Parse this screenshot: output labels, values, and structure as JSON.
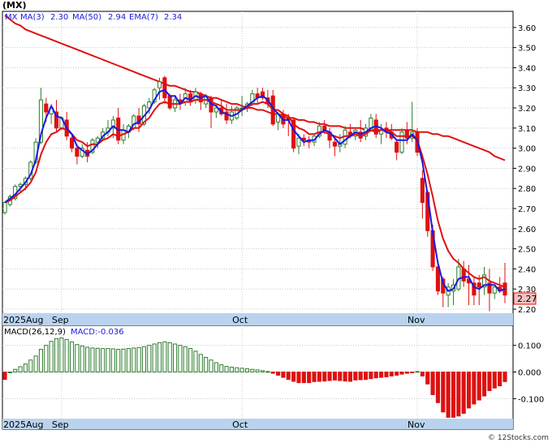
{
  "title": "(MX)",
  "credit": "© 12Stocks.com",
  "price_legend": {
    "symbol": "MX",
    "ma3_label": "MA(3)",
    "ma3_value": "2.30",
    "ma50_label": "MA(50)",
    "ma50_value": "2.94",
    "ema7_label": "EMA(7)",
    "ema7_value": "2.34"
  },
  "macd_legend": {
    "label": "MACD(26,12,9)",
    "value_label": "MACD:-0.036"
  },
  "last_price_label": "2.27",
  "colors": {
    "up": "#2e7d2e",
    "down": "#dd1111",
    "ma_red": "#e01010",
    "ma_blue": "#1a1ae0",
    "axis_band": "#b9d3ee",
    "grid": "#c8c8c8",
    "macd_pos": "#2e7d2e",
    "macd_neg": "#dd1111"
  },
  "chart_data": [
    {
      "type": "candlestick",
      "ylim": [
        2.18,
        3.68
      ],
      "yticks": [
        "3.60",
        "3.50",
        "3.40",
        "3.30",
        "3.20",
        "3.10",
        "3.00",
        "2.90",
        "2.80",
        "2.70",
        "2.60",
        "2.50",
        "2.40",
        "2.30",
        "2.20"
      ],
      "xticks": [
        {
          "label": "2025Aug",
          "index": 0
        },
        {
          "label": "Sep",
          "index": 11
        },
        {
          "label": "Oct",
          "index": 46
        },
        {
          "label": "Nov",
          "index": 80
        }
      ],
      "candles": [
        [
          2.68,
          2.73,
          2.67,
          2.73
        ],
        [
          2.72,
          2.77,
          2.71,
          2.76
        ],
        [
          2.75,
          2.82,
          2.74,
          2.81
        ],
        [
          2.81,
          2.83,
          2.78,
          2.82
        ],
        [
          2.82,
          2.86,
          2.79,
          2.85
        ],
        [
          2.85,
          2.94,
          2.84,
          2.93
        ],
        [
          2.93,
          3.05,
          2.92,
          3.03
        ],
        [
          3.03,
          3.3,
          3.02,
          3.24
        ],
        [
          3.22,
          3.25,
          3.13,
          3.18
        ],
        [
          3.17,
          3.22,
          3.12,
          3.2
        ],
        [
          3.18,
          3.24,
          3.08,
          3.1
        ],
        [
          3.1,
          3.16,
          3.09,
          3.15
        ],
        [
          3.14,
          3.18,
          3.04,
          3.06
        ],
        [
          3.05,
          3.07,
          2.98,
          3.0
        ],
        [
          3.0,
          3.02,
          2.92,
          2.96
        ],
        [
          2.96,
          3.02,
          2.95,
          3.0
        ],
        [
          2.99,
          3.03,
          2.93,
          2.96
        ],
        [
          2.98,
          3.05,
          2.97,
          3.04
        ],
        [
          3.03,
          3.06,
          3.0,
          3.05
        ],
        [
          3.05,
          3.1,
          3.04,
          3.08
        ],
        [
          3.08,
          3.14,
          3.06,
          3.1
        ],
        [
          3.1,
          3.16,
          3.05,
          3.14
        ],
        [
          3.15,
          3.2,
          3.02,
          3.04
        ],
        [
          3.04,
          3.12,
          3.02,
          3.09
        ],
        [
          3.08,
          3.12,
          3.05,
          3.11
        ],
        [
          3.1,
          3.17,
          3.09,
          3.16
        ],
        [
          3.16,
          3.2,
          3.08,
          3.12
        ],
        [
          3.12,
          3.22,
          3.11,
          3.21
        ],
        [
          3.2,
          3.25,
          3.17,
          3.23
        ],
        [
          3.23,
          3.3,
          3.22,
          3.29
        ],
        [
          3.3,
          3.35,
          3.24,
          3.33
        ],
        [
          3.35,
          3.36,
          3.22,
          3.25
        ],
        [
          3.26,
          3.27,
          3.19,
          3.2
        ],
        [
          3.2,
          3.26,
          3.18,
          3.24
        ],
        [
          3.24,
          3.27,
          3.19,
          3.23
        ],
        [
          3.23,
          3.3,
          3.21,
          3.27
        ],
        [
          3.27,
          3.29,
          3.21,
          3.23
        ],
        [
          3.24,
          3.3,
          3.22,
          3.28
        ],
        [
          3.27,
          3.28,
          3.19,
          3.23
        ],
        [
          3.22,
          3.27,
          3.2,
          3.26
        ],
        [
          3.25,
          3.26,
          3.1,
          3.18
        ],
        [
          3.18,
          3.22,
          3.15,
          3.2
        ],
        [
          3.2,
          3.24,
          3.16,
          3.17
        ],
        [
          3.18,
          3.22,
          3.12,
          3.14
        ],
        [
          3.14,
          3.21,
          3.12,
          3.18
        ],
        [
          3.15,
          3.21,
          3.14,
          3.2
        ],
        [
          3.2,
          3.26,
          3.16,
          3.2
        ],
        [
          3.2,
          3.23,
          3.18,
          3.22
        ],
        [
          3.22,
          3.29,
          3.21,
          3.27
        ],
        [
          3.27,
          3.3,
          3.22,
          3.25
        ],
        [
          3.28,
          3.3,
          3.24,
          3.25
        ],
        [
          3.25,
          3.29,
          3.2,
          3.22
        ],
        [
          3.26,
          3.29,
          3.11,
          3.12
        ],
        [
          3.13,
          3.18,
          3.09,
          3.17
        ],
        [
          3.17,
          3.19,
          3.1,
          3.12
        ],
        [
          3.15,
          3.17,
          3.06,
          3.14
        ],
        [
          3.14,
          3.15,
          2.98,
          3.0
        ],
        [
          3.01,
          3.07,
          2.97,
          3.05
        ],
        [
          3.05,
          3.07,
          3.01,
          3.04
        ],
        [
          3.04,
          3.06,
          3.0,
          3.03
        ],
        [
          3.03,
          3.07,
          3.01,
          3.06
        ],
        [
          3.06,
          3.13,
          3.05,
          3.11
        ],
        [
          3.11,
          3.14,
          3.07,
          3.09
        ],
        [
          3.08,
          3.1,
          3.0,
          3.04
        ],
        [
          3.03,
          3.05,
          2.96,
          3.01
        ],
        [
          3.01,
          3.07,
          2.98,
          3.02
        ],
        [
          3.02,
          3.11,
          3.0,
          3.09
        ],
        [
          3.08,
          3.12,
          3.05,
          3.06
        ],
        [
          3.06,
          3.1,
          3.04,
          3.09
        ],
        [
          3.08,
          3.14,
          3.03,
          3.05
        ],
        [
          3.06,
          3.12,
          3.04,
          3.1
        ],
        [
          3.09,
          3.17,
          3.08,
          3.15
        ],
        [
          3.14,
          3.17,
          3.05,
          3.07
        ],
        [
          3.07,
          3.12,
          3.02,
          3.09
        ],
        [
          3.1,
          3.13,
          3.05,
          3.08
        ],
        [
          3.08,
          3.12,
          3.04,
          3.05
        ],
        [
          3.03,
          3.04,
          2.94,
          2.98
        ],
        [
          2.98,
          3.1,
          2.97,
          3.08
        ],
        [
          3.09,
          3.13,
          3.02,
          3.05
        ],
        [
          3.05,
          3.23,
          3.03,
          3.08
        ],
        [
          3.08,
          3.1,
          2.96,
          2.98
        ],
        [
          2.85,
          2.89,
          2.65,
          2.73
        ],
        [
          2.78,
          2.79,
          2.56,
          2.59
        ],
        [
          2.59,
          2.62,
          2.39,
          2.41
        ],
        [
          2.41,
          2.43,
          2.27,
          2.29
        ],
        [
          2.35,
          2.36,
          2.21,
          2.28
        ],
        [
          2.27,
          2.33,
          2.21,
          2.31
        ],
        [
          2.29,
          2.35,
          2.22,
          2.32
        ],
        [
          2.3,
          2.45,
          2.29,
          2.41
        ],
        [
          2.4,
          2.44,
          2.31,
          2.34
        ],
        [
          2.35,
          2.42,
          2.22,
          2.33
        ],
        [
          2.33,
          2.36,
          2.22,
          2.27
        ],
        [
          2.33,
          2.37,
          2.22,
          2.31
        ],
        [
          2.31,
          2.41,
          2.27,
          2.37
        ],
        [
          2.33,
          2.4,
          2.19,
          2.28
        ],
        [
          2.28,
          2.31,
          2.25,
          2.31
        ],
        [
          2.31,
          2.36,
          2.28,
          2.29
        ],
        [
          2.33,
          2.43,
          2.23,
          2.27
        ]
      ],
      "ma3": [
        2.73,
        2.75,
        2.77,
        2.8,
        2.83,
        2.87,
        2.94,
        3.07,
        3.15,
        3.21,
        3.16,
        3.15,
        3.1,
        3.07,
        3.01,
        2.99,
        2.97,
        2.99,
        3.02,
        3.06,
        3.08,
        3.11,
        3.09,
        3.09,
        3.08,
        3.12,
        3.13,
        3.16,
        3.19,
        3.24,
        3.28,
        3.29,
        3.26,
        3.26,
        3.22,
        3.25,
        3.24,
        3.26,
        3.25,
        3.26,
        3.22,
        3.21,
        3.18,
        3.17,
        3.16,
        3.17,
        3.19,
        3.21,
        3.23,
        3.25,
        3.26,
        3.24,
        3.2,
        3.17,
        3.14,
        3.14,
        3.09,
        3.06,
        3.03,
        3.04,
        3.04,
        3.07,
        3.09,
        3.08,
        3.05,
        3.02,
        3.04,
        3.06,
        3.08,
        3.07,
        3.08,
        3.1,
        3.11,
        3.1,
        3.08,
        3.07,
        3.04,
        3.04,
        3.04,
        3.07,
        3.04,
        2.93,
        2.77,
        2.58,
        2.43,
        2.33,
        2.29,
        2.3,
        2.35,
        2.36,
        2.36,
        2.31,
        2.3,
        2.32,
        2.32,
        2.32,
        2.29,
        2.3
      ],
      "ema7": [
        2.73,
        2.74,
        2.76,
        2.78,
        2.8,
        2.83,
        2.88,
        2.97,
        3.03,
        3.07,
        3.08,
        3.1,
        3.09,
        3.07,
        3.04,
        3.03,
        3.01,
        3.02,
        3.02,
        3.04,
        3.05,
        3.07,
        3.06,
        3.07,
        3.08,
        3.1,
        3.1,
        3.13,
        3.15,
        3.19,
        3.22,
        3.23,
        3.22,
        3.22,
        3.22,
        3.23,
        3.23,
        3.24,
        3.24,
        3.24,
        3.23,
        3.22,
        3.21,
        3.19,
        3.19,
        3.19,
        3.19,
        3.2,
        3.22,
        3.22,
        3.23,
        3.22,
        3.19,
        3.19,
        3.17,
        3.16,
        3.12,
        3.1,
        3.09,
        3.07,
        3.07,
        3.08,
        3.08,
        3.07,
        3.06,
        3.05,
        3.06,
        3.06,
        3.07,
        3.06,
        3.07,
        3.09,
        3.08,
        3.09,
        3.09,
        3.08,
        3.06,
        3.06,
        3.06,
        3.06,
        3.04,
        2.96,
        2.87,
        2.76,
        2.64,
        2.55,
        2.49,
        2.45,
        2.43,
        2.4,
        2.38,
        2.36,
        2.35,
        2.36,
        2.34,
        2.33,
        2.32,
        2.31
      ],
      "ma50_start_index": 0,
      "ma50": [
        3.66,
        3.64,
        3.62,
        3.61,
        3.59,
        3.58,
        3.57,
        3.56,
        3.55,
        3.54,
        3.53,
        3.52,
        3.51,
        3.5,
        3.49,
        3.48,
        3.47,
        3.46,
        3.45,
        3.44,
        3.43,
        3.42,
        3.41,
        3.4,
        3.39,
        3.38,
        3.37,
        3.36,
        3.35,
        3.34,
        3.33,
        3.32,
        3.31,
        3.31,
        3.3,
        3.29,
        3.28,
        3.28,
        3.27,
        3.26,
        3.25,
        3.25,
        3.24,
        3.23,
        3.22,
        3.22,
        3.21,
        3.2,
        3.2,
        3.19,
        3.19,
        3.18,
        3.17,
        3.17,
        3.16,
        3.15,
        3.15,
        3.14,
        3.14,
        3.13,
        3.13,
        3.12,
        3.12,
        3.11,
        3.11,
        3.11,
        3.1,
        3.1,
        3.1,
        3.1,
        3.09,
        3.09,
        3.09,
        3.09,
        3.09,
        3.09,
        3.09,
        3.09,
        3.09,
        3.09,
        3.08,
        3.08,
        3.08,
        3.07,
        3.07,
        3.06,
        3.06,
        3.05,
        3.04,
        3.03,
        3.02,
        3.01,
        3.0,
        2.99,
        2.98,
        2.96,
        2.95,
        2.94
      ]
    },
    {
      "type": "bar",
      "title": "MACD(26,12,9)",
      "ylim": [
        -0.175,
        0.175
      ],
      "yticks": [
        "0.100",
        "0.000",
        "-0.100"
      ],
      "xticks": [
        {
          "label": "2025Aug",
          "index": 0
        },
        {
          "label": "Sep",
          "index": 11
        },
        {
          "label": "Oct",
          "index": 46
        },
        {
          "label": "Nov",
          "index": 80
        }
      ],
      "values": [
        -0.028,
        0.0,
        0.01,
        0.02,
        0.03,
        0.045,
        0.06,
        0.085,
        0.1,
        0.115,
        0.125,
        0.128,
        0.122,
        0.113,
        0.103,
        0.098,
        0.093,
        0.09,
        0.089,
        0.088,
        0.088,
        0.087,
        0.085,
        0.086,
        0.088,
        0.09,
        0.092,
        0.095,
        0.1,
        0.105,
        0.11,
        0.113,
        0.11,
        0.105,
        0.1,
        0.095,
        0.088,
        0.078,
        0.066,
        0.055,
        0.045,
        0.035,
        0.027,
        0.021,
        0.018,
        0.016,
        0.014,
        0.012,
        0.01,
        0.008,
        0.005,
        0.002,
        -0.005,
        -0.012,
        -0.02,
        -0.028,
        -0.035,
        -0.04,
        -0.04,
        -0.04,
        -0.036,
        -0.035,
        -0.034,
        -0.032,
        -0.03,
        -0.032,
        -0.034,
        -0.035,
        -0.03,
        -0.029,
        -0.028,
        -0.025,
        -0.022,
        -0.02,
        -0.018,
        -0.015,
        -0.012,
        -0.008,
        -0.005,
        -0.002,
        0.002,
        -0.015,
        -0.045,
        -0.085,
        -0.115,
        -0.15,
        -0.17,
        -0.17,
        -0.165,
        -0.155,
        -0.135,
        -0.12,
        -0.105,
        -0.09,
        -0.07,
        -0.06,
        -0.052,
        -0.036
      ]
    }
  ]
}
